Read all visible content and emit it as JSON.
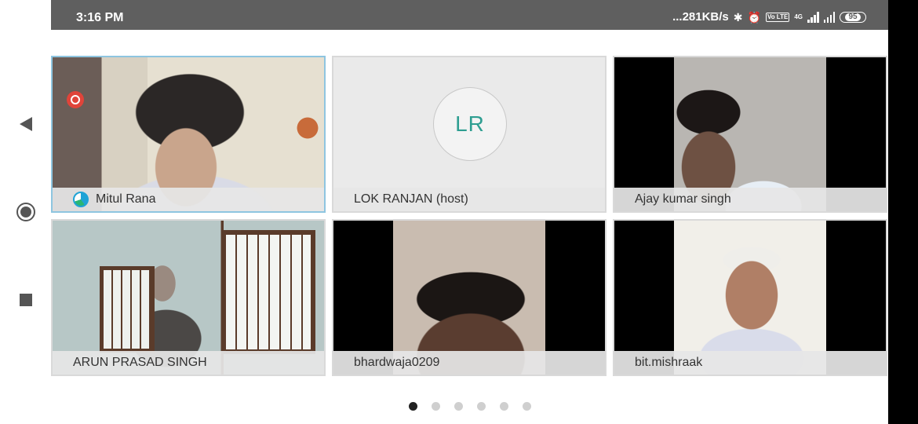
{
  "status_bar": {
    "time": "3:16 PM",
    "network_speed": "...281KB/s",
    "network_type": "4G",
    "lte_badge": "Vo LTE",
    "battery": "95",
    "icons": [
      "bluetooth-icon",
      "alarm-icon",
      "volte-icon",
      "signal-icon",
      "signal-icon",
      "battery-icon"
    ]
  },
  "nav_bar": {
    "icons": [
      "back-icon",
      "home-icon",
      "recents-icon"
    ]
  },
  "participants": [
    {
      "name": "Mitul Rana",
      "video": true,
      "active_speaker": true,
      "recording": true
    },
    {
      "name": "LOK RANJAN (host)",
      "video": false,
      "initials": "LR"
    },
    {
      "name": "Ajay kumar singh",
      "video": true
    },
    {
      "name": "ARUN PRASAD SINGH",
      "video": true
    },
    {
      "name": "bhardwaja0209",
      "video": true
    },
    {
      "name": "bit.mishraak",
      "video": true
    }
  ],
  "pagination": {
    "total_pages": 6,
    "current_page": 1
  },
  "colors": {
    "active_border": "#8ec5e0",
    "initials_color": "#2e9e91",
    "recording": "#e0443a"
  }
}
